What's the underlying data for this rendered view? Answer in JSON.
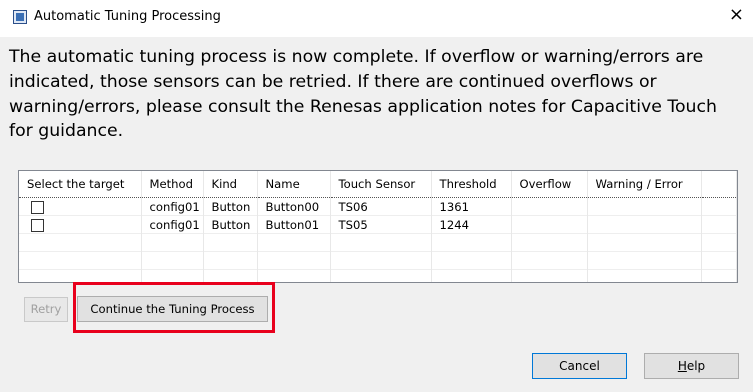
{
  "window": {
    "title": "Automatic Tuning Processing",
    "close_glyph": "×",
    "app_icon": "app-window-icon"
  },
  "message": "The automatic tuning process is now complete. If overflow or warning/errors are indicated, those sensors can be retried. If there are continued overflows or warning/errors, please consult the Renesas application notes for Capacitive Touch for guidance.",
  "table": {
    "columns": [
      "Select the target",
      "Method",
      "Kind",
      "Name",
      "Touch Sensor",
      "Threshold",
      "Overflow",
      "Warning / Error"
    ],
    "rows": [
      {
        "selected": false,
        "method": "config01",
        "kind": "Button",
        "name": "Button00",
        "touch_sensor": "TS06",
        "threshold": "1361",
        "overflow": "",
        "warning_error": ""
      },
      {
        "selected": false,
        "method": "config01",
        "kind": "Button",
        "name": "Button01",
        "touch_sensor": "TS05",
        "threshold": "1244",
        "overflow": "",
        "warning_error": ""
      }
    ]
  },
  "buttons": {
    "retry": "Retry",
    "continue": "Continue the Tuning Process",
    "cancel": "Cancel",
    "help_mnemonic": "H",
    "help_rest": "elp"
  },
  "colors": {
    "highlight": "#e8001c",
    "default_button_border": "#0078d7"
  }
}
